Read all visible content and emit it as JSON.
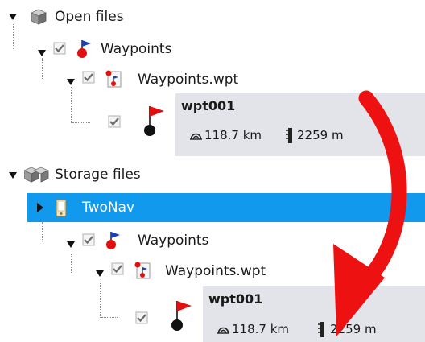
{
  "tree": {
    "open_files": {
      "label": "Open files",
      "waypoints_group": {
        "label": "Waypoints",
        "checked": true
      },
      "file": {
        "label": "Waypoints.wpt",
        "checked": true
      },
      "waypoint": {
        "name": "wpt001",
        "distance": "118.7 km",
        "altitude": "2259 m",
        "checked": true
      }
    },
    "storage_files": {
      "label": "Storage files",
      "device": {
        "label": "TwoNav",
        "selected": true
      },
      "waypoints_group": {
        "label": "Waypoints",
        "checked": true
      },
      "file": {
        "label": "Waypoints.wpt",
        "checked": true
      },
      "waypoint": {
        "name": "wpt001",
        "distance": "118.7 km",
        "altitude": "2259 m",
        "checked": true
      }
    }
  },
  "icons": {
    "expand_open": "triangle-down",
    "expand_closed": "triangle-right",
    "folder": "cube-folder-icon",
    "waypoints": "flag-group-icon",
    "file": "wpt-file-icon",
    "waypoint": "flag-pin-icon",
    "distance": "distance-icon",
    "altitude": "altitude-icon",
    "device": "gps-device-icon"
  },
  "colors": {
    "selection": "#1199ee",
    "panel": "#e3e3ea",
    "arrow": "#ee1111",
    "flag_red": "#e01010",
    "flag_blue": "#1a3fb8"
  }
}
